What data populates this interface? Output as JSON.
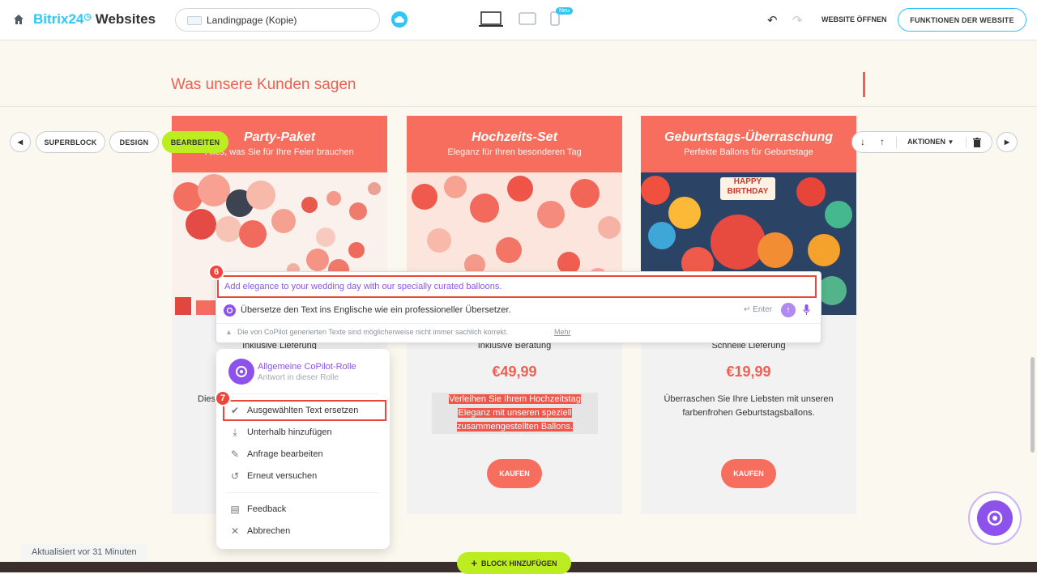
{
  "topbar": {
    "app_name": "Bitrix24",
    "app_suffix": "Websites",
    "page_name": "Landingpage (Kopie)",
    "new_badge": "Neu",
    "open_website": "WEBSITE ÖFFNEN",
    "website_functions": "FUNKTIONEN DER WEBSITE"
  },
  "section": {
    "title": "Was unsere Kunden sagen"
  },
  "block_toolbar": {
    "superblock": "SUPERBLOCK",
    "design": "DESIGN",
    "edit": "BEARBEITEN",
    "actions": "AKTIONEN"
  },
  "cards": [
    {
      "title": "Party-Paket",
      "subtitle": "Alles, was Sie für Ihre Feier brauchen",
      "feature": "Inklusive Lieferung",
      "desc_fragment": "Dies"
    },
    {
      "title": "Hochzeits-Set",
      "subtitle": "Eleganz für Ihren besonderen Tag",
      "feature": "Inklusive Beratung",
      "price": "€49,99",
      "description": "Verleihen Sie Ihrem Hochzeitstag Eleganz mit unseren speziell zusammengestellten Ballons.",
      "buy": "KAUFEN"
    },
    {
      "title": "Geburtstags-Überraschung",
      "subtitle": "Perfekte Ballons für Geburtstage",
      "feature": "Schnelle Lieferung",
      "price": "€19,99",
      "description": "Überraschen Sie Ihre Liebsten mit unseren farbenfrohen Geburtstagsballons.",
      "buy": "KAUFEN",
      "image_text": "HAPPY BIRTHDAY"
    }
  ],
  "copilot": {
    "step_result": "6",
    "result_text": "Add elegance to your wedding day with our specially curated balloons.",
    "prompt": "Übersetze den Text ins Englische wie ein professioneller Übersetzer.",
    "enter_hint": "Enter",
    "disclaimer": "Die von CoPilot generierten Texte sind möglicherweise nicht immer sachlich korrekt.",
    "more_link": "Mehr",
    "role_title": "Allgemeine CoPilot-Rolle",
    "role_sub": "Antwort in dieser Rolle",
    "step_menu": "7",
    "menu": [
      {
        "label": "Ausgewählten Text ersetzen",
        "icon": "check-icon"
      },
      {
        "label": "Unterhalb hinzufügen",
        "icon": "download-icon"
      },
      {
        "label": "Anfrage bearbeiten",
        "icon": "pencil-icon"
      },
      {
        "label": "Erneut versuchen",
        "icon": "retry-icon"
      },
      {
        "label": "Feedback",
        "icon": "feedback-icon"
      },
      {
        "label": "Abbrechen",
        "icon": "close-icon"
      }
    ]
  },
  "footer": {
    "updated": "Aktualisiert vor 31 Minuten",
    "add_block": "BLOCK HINZUFÜGEN"
  },
  "colors": {
    "accent": "#f86e5e",
    "brand": "#2fc6f6",
    "edit_green": "#bbed21",
    "copilot_purple": "#8e52ec"
  }
}
